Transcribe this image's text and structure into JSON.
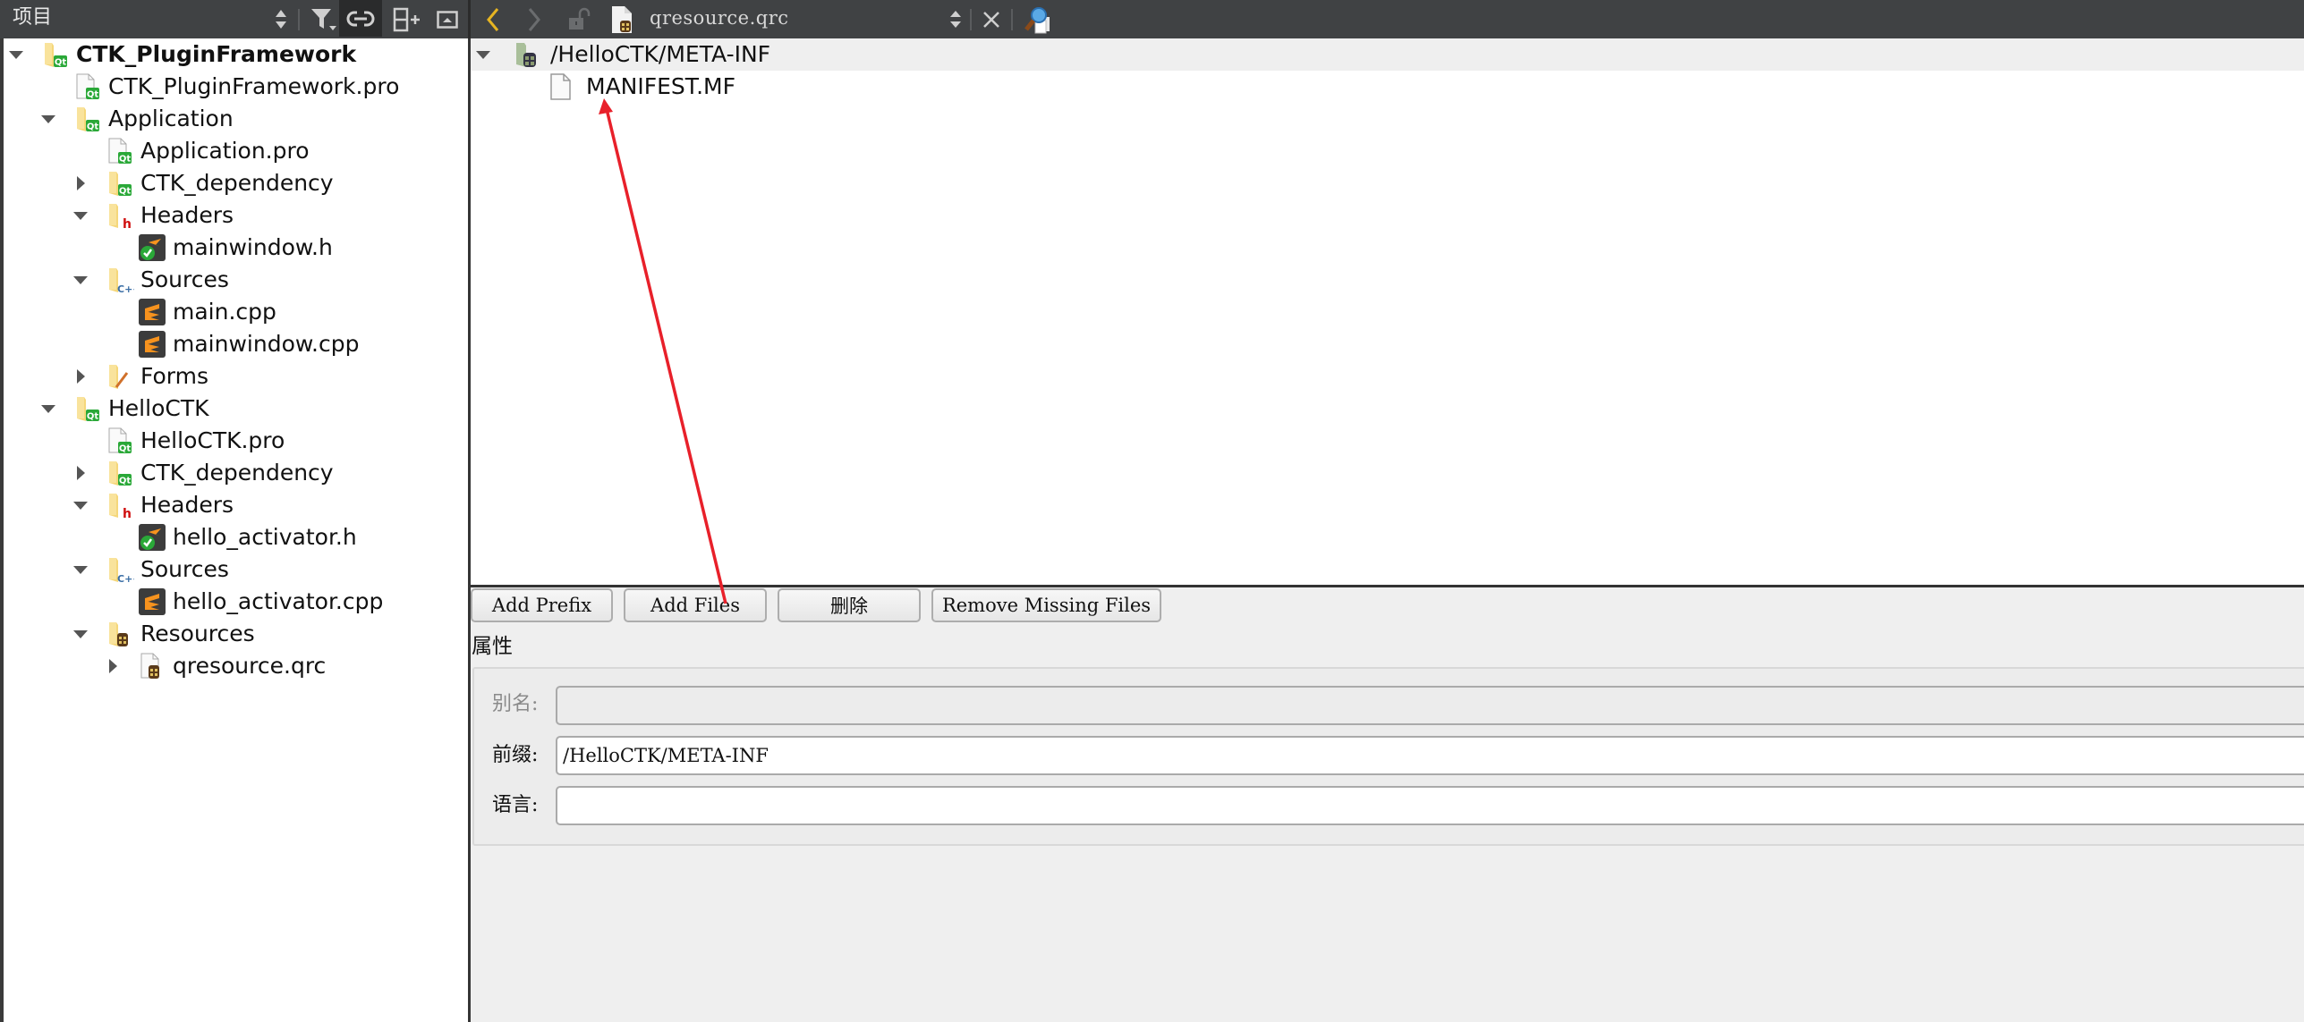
{
  "toolbar": {
    "panel_title": "项目",
    "current_file": "qresource.qrc",
    "icons": [
      "sort-updown-icon",
      "filter-icon",
      "link-sync-icon",
      "split-add-icon",
      "hide-panel-icon",
      "back-arrow-icon",
      "forward-arrow-icon",
      "lock-icon",
      "qrc-file-icon",
      "combo-updown-icon",
      "close-icon",
      "locate-file-icon"
    ]
  },
  "project_tree": {
    "items": [
      {
        "label": "CTK_PluginFramework",
        "depth": 0,
        "expander": "expanded",
        "icon": "qt-folder",
        "bold": true
      },
      {
        "label": "CTK_PluginFramework.pro",
        "depth": 1,
        "expander": "none",
        "icon": "qt-pro-file"
      },
      {
        "label": "Application",
        "depth": 1,
        "expander": "expanded",
        "icon": "qt-folder"
      },
      {
        "label": "Application.pro",
        "depth": 2,
        "expander": "none",
        "icon": "qt-pro-file"
      },
      {
        "label": "CTK_dependency",
        "depth": 2,
        "expander": "collapsed",
        "icon": "qt-folder"
      },
      {
        "label": "Headers",
        "depth": 2,
        "expander": "expanded",
        "icon": "headers-folder"
      },
      {
        "label": "mainwindow.h",
        "depth": 3,
        "expander": "none",
        "icon": "header-file"
      },
      {
        "label": "Sources",
        "depth": 2,
        "expander": "expanded",
        "icon": "sources-folder"
      },
      {
        "label": "main.cpp",
        "depth": 3,
        "expander": "none",
        "icon": "cpp-file"
      },
      {
        "label": "mainwindow.cpp",
        "depth": 3,
        "expander": "none",
        "icon": "cpp-file"
      },
      {
        "label": "Forms",
        "depth": 2,
        "expander": "collapsed",
        "icon": "forms-folder"
      },
      {
        "label": "HelloCTK",
        "depth": 1,
        "expander": "expanded",
        "icon": "qt-folder"
      },
      {
        "label": "HelloCTK.pro",
        "depth": 2,
        "expander": "none",
        "icon": "qt-pro-file"
      },
      {
        "label": "CTK_dependency",
        "depth": 2,
        "expander": "collapsed",
        "icon": "qt-folder"
      },
      {
        "label": "Headers",
        "depth": 2,
        "expander": "expanded",
        "icon": "headers-folder"
      },
      {
        "label": "hello_activator.h",
        "depth": 3,
        "expander": "none",
        "icon": "header-file"
      },
      {
        "label": "Sources",
        "depth": 2,
        "expander": "expanded",
        "icon": "sources-folder"
      },
      {
        "label": "hello_activator.cpp",
        "depth": 3,
        "expander": "none",
        "icon": "cpp-file"
      },
      {
        "label": "Resources",
        "depth": 2,
        "expander": "expanded",
        "icon": "resources-folder"
      },
      {
        "label": "qresource.qrc",
        "depth": 3,
        "expander": "collapsed",
        "icon": "qrc-file"
      }
    ]
  },
  "resource_tree": {
    "prefix": "/HelloCTK/META-INF",
    "files": [
      "MANIFEST.MF"
    ]
  },
  "buttons": {
    "add_prefix": "Add Prefix",
    "add_files": "Add Files",
    "remove": "删除",
    "remove_missing": "Remove Missing Files"
  },
  "properties": {
    "section_title": "属性",
    "alias_label": "别名:",
    "alias_value": "",
    "prefix_label": "前缀:",
    "prefix_value": "/HelloCTK/META-INF",
    "language_label": "语言:",
    "language_value": ""
  },
  "annotation": {
    "type": "red-arrow",
    "color": "#e8202a",
    "from": "add-files-button",
    "to": "manifest-file-item"
  },
  "colors": {
    "toolbar_bg": "#404244",
    "back_arrow": "#e6b422",
    "qt_green": "#41cd52",
    "folder_yellow": "#f5d77a",
    "selection_bg": "#efefef"
  }
}
